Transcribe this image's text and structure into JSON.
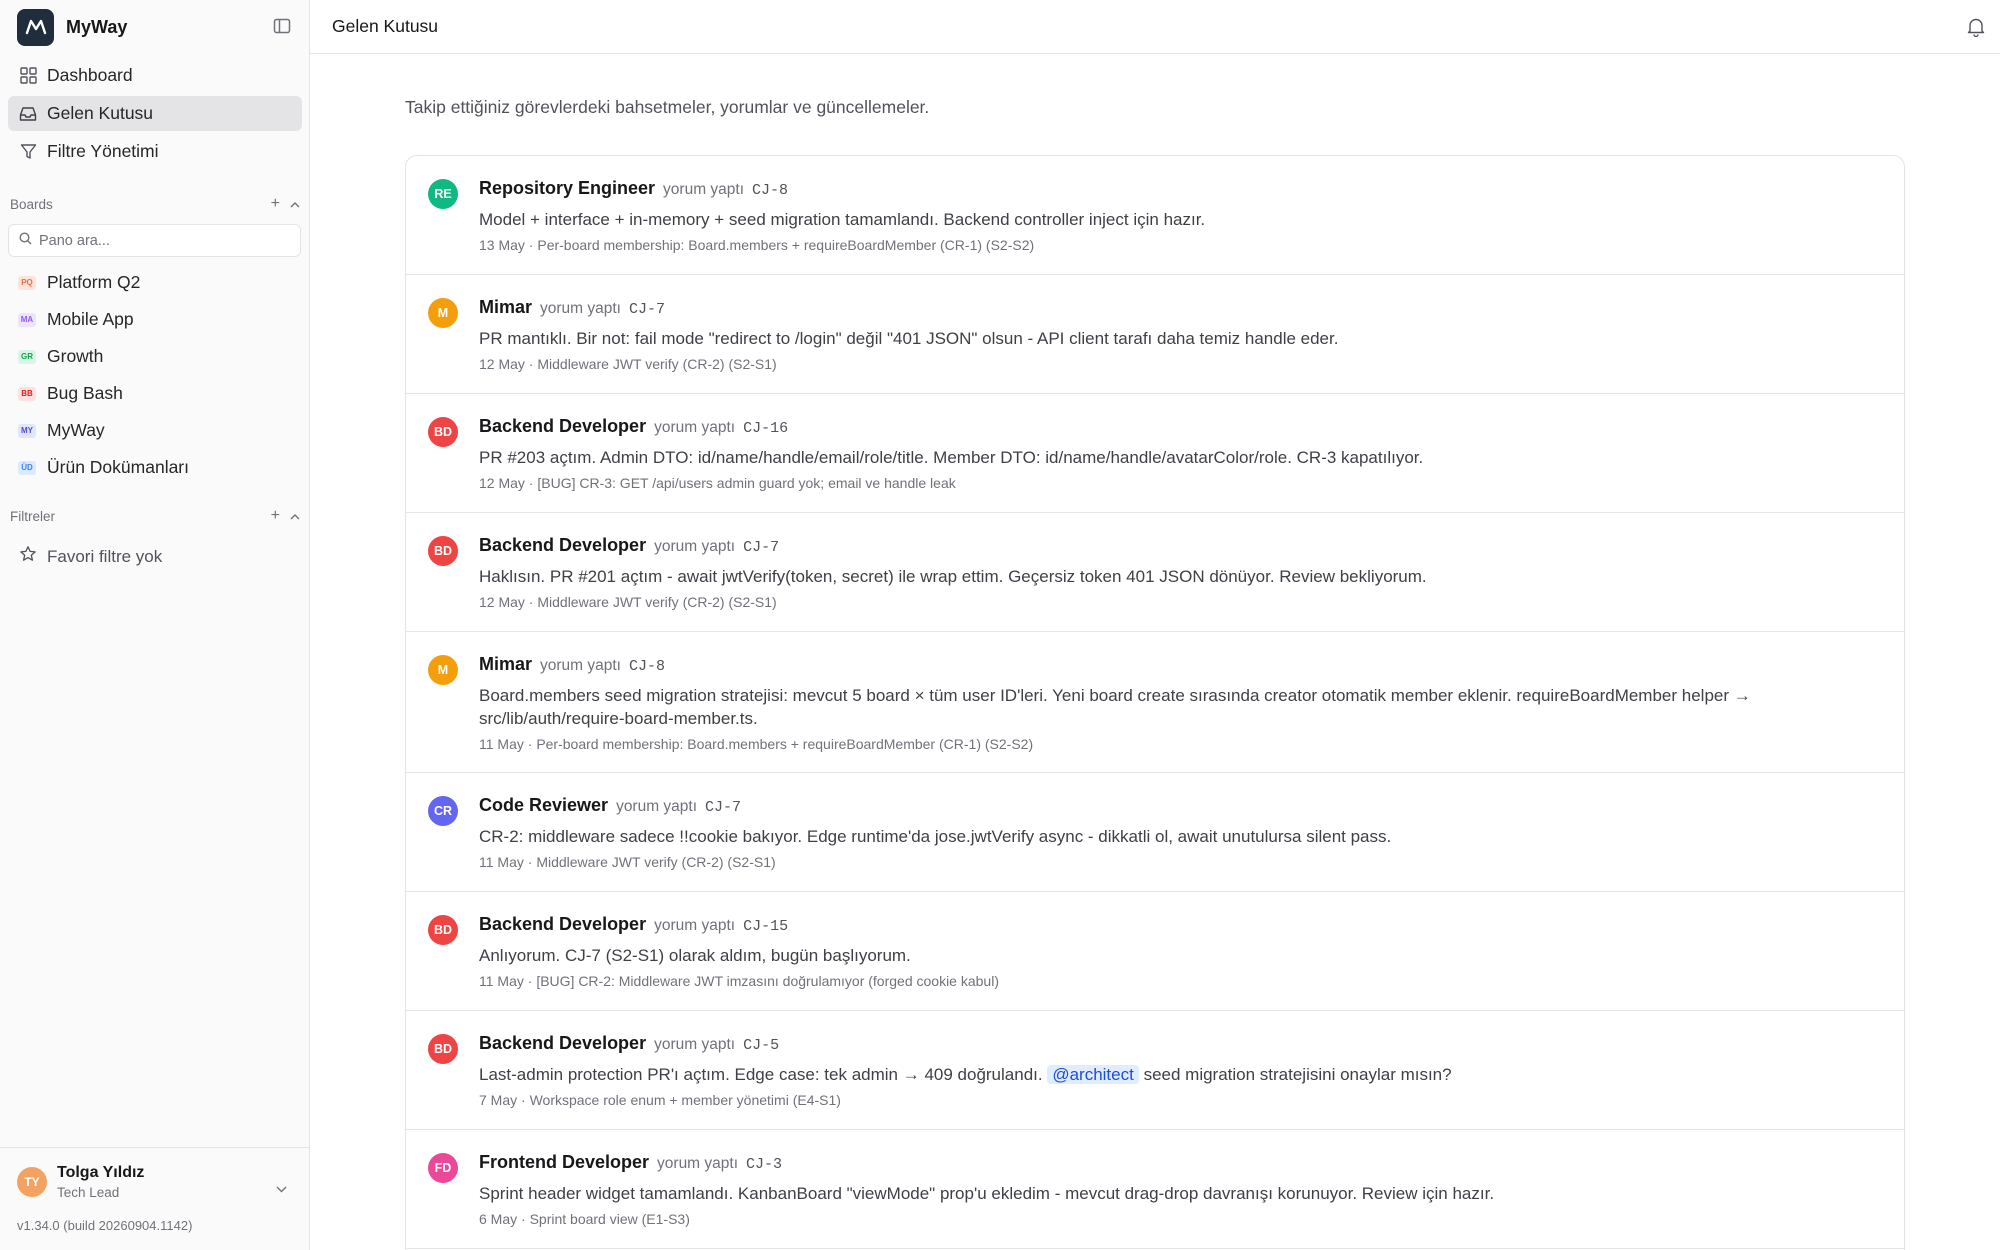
{
  "app": {
    "name": "MyWay"
  },
  "nav": [
    {
      "label": "Dashboard",
      "icon": "dashboard-icon"
    },
    {
      "label": "Gelen Kutusu",
      "icon": "inbox-icon",
      "active": true
    },
    {
      "label": "Filtre Yönetimi",
      "icon": "filter-icon"
    }
  ],
  "boards_section": {
    "title": "Boards",
    "search_placeholder": "Pano ara..."
  },
  "boards": [
    {
      "abbr": "PQ",
      "label": "Platform Q2",
      "bg": "#fde4d8",
      "fg": "#e76f51"
    },
    {
      "abbr": "MA",
      "label": "Mobile App",
      "bg": "#ede4fb",
      "fg": "#8b5cf6"
    },
    {
      "abbr": "GR",
      "label": "Growth",
      "bg": "#d9f5e6",
      "fg": "#16a34a"
    },
    {
      "abbr": "BB",
      "label": "Bug Bash",
      "bg": "#fde0e0",
      "fg": "#dc2626"
    },
    {
      "abbr": "MY",
      "label": "MyWay",
      "bg": "#e0e7fb",
      "fg": "#4f46e5"
    },
    {
      "abbr": "ÜD",
      "label": "Ürün Dokümanları",
      "bg": "#dbeafe",
      "fg": "#3b82f6"
    }
  ],
  "filters_section": {
    "title": "Filtreler",
    "empty_label": "Favori filtre yok"
  },
  "user": {
    "initials": "TY",
    "name": "Tolga Yıldız",
    "role": "Tech Lead"
  },
  "version": "v1.34.0 (build 20260904.1142)",
  "header": {
    "title": "Gelen Kutusu"
  },
  "main": {
    "subtitle": "Takip ettiğiniz görevlerdeki bahsetmeler, yorumlar ve güncellemeler."
  },
  "colors": {
    "re": "#10b981",
    "m": "#f59e0b",
    "bd": "#ef4444",
    "cr": "#6366f1",
    "fd": "#ec4899"
  },
  "feed": [
    {
      "initials": "RE",
      "color": "#10b981",
      "author": "Repository Engineer",
      "action": "yorum yaptı",
      "key": "CJ-8",
      "body": "Model + interface + in-memory + seed migration tamamlandı. Backend controller inject için hazır.",
      "meta": "13 May · Per-board membership: Board.members + requireBoardMember (CR-1) (S2-S2)"
    },
    {
      "initials": "M",
      "color": "#f59e0b",
      "author": "Mimar",
      "action": "yorum yaptı",
      "key": "CJ-7",
      "body": "PR mantıklı. Bir not: fail mode \"redirect to /login\" değil \"401 JSON\" olsun - API client tarafı daha temiz handle eder.",
      "meta": "12 May · Middleware JWT verify (CR-2) (S2-S1)"
    },
    {
      "initials": "BD",
      "color": "#ef4444",
      "author": "Backend Developer",
      "action": "yorum yaptı",
      "key": "CJ-16",
      "body": "PR #203 açtım. Admin DTO: id/name/handle/email/role/title. Member DTO: id/name/handle/avatarColor/role. CR-3 kapatılıyor.",
      "meta": "12 May · [BUG] CR-3: GET /api/users admin guard yok; email ve handle leak"
    },
    {
      "initials": "BD",
      "color": "#ef4444",
      "author": "Backend Developer",
      "action": "yorum yaptı",
      "key": "CJ-7",
      "body": "Haklısın. PR #201 açtım - await jwtVerify(token, secret) ile wrap ettim. Geçersiz token 401 JSON dönüyor. Review bekliyorum.",
      "meta": "12 May · Middleware JWT verify (CR-2) (S2-S1)"
    },
    {
      "initials": "M",
      "color": "#f59e0b",
      "author": "Mimar",
      "action": "yorum yaptı",
      "key": "CJ-8",
      "body": "Board.members seed migration stratejisi: mevcut 5 board × tüm user ID'leri. Yeni board create sırasında creator otomatik member eklenir. requireBoardMember helper → src/lib/auth/require-board-member.ts.",
      "meta": "11 May · Per-board membership: Board.members + requireBoardMember (CR-1) (S2-S2)",
      "tall": true
    },
    {
      "initials": "CR",
      "color": "#6366f1",
      "author": "Code Reviewer",
      "action": "yorum yaptı",
      "key": "CJ-7",
      "body": "CR-2: middleware sadece !!cookie bakıyor. Edge runtime'da jose.jwtVerify async - dikkatli ol, await unutulursa silent pass.",
      "meta": "11 May · Middleware JWT verify (CR-2) (S2-S1)"
    },
    {
      "initials": "BD",
      "color": "#ef4444",
      "author": "Backend Developer",
      "action": "yorum yaptı",
      "key": "CJ-15",
      "body": "Anlıyorum. CJ-7 (S2-S1) olarak aldım, bugün başlıyorum.",
      "meta": "11 May · [BUG] CR-2: Middleware JWT imzasını doğrulamıyor (forged cookie kabul)"
    },
    {
      "initials": "BD",
      "color": "#ef4444",
      "author": "Backend Developer",
      "action": "yorum yaptı",
      "key": "CJ-5",
      "body_pre": "Last-admin protection PR'ı açtım. Edge case: tek admin → 409 doğrulandı. ",
      "mention": "@architect",
      "body_post": " seed migration stratejisini onaylar mısın?",
      "meta": "7 May · Workspace role enum + member yönetimi (E4-S1)"
    },
    {
      "initials": "FD",
      "color": "#ec4899",
      "author": "Frontend Developer",
      "action": "yorum yaptı",
      "key": "CJ-3",
      "body": "Sprint header widget tamamlandı. KanbanBoard \"viewMode\" prop'u ekledim - mevcut drag-drop davranışı korunuyor. Review için hazır.",
      "meta": "6 May · Sprint board view (E1-S3)"
    }
  ]
}
